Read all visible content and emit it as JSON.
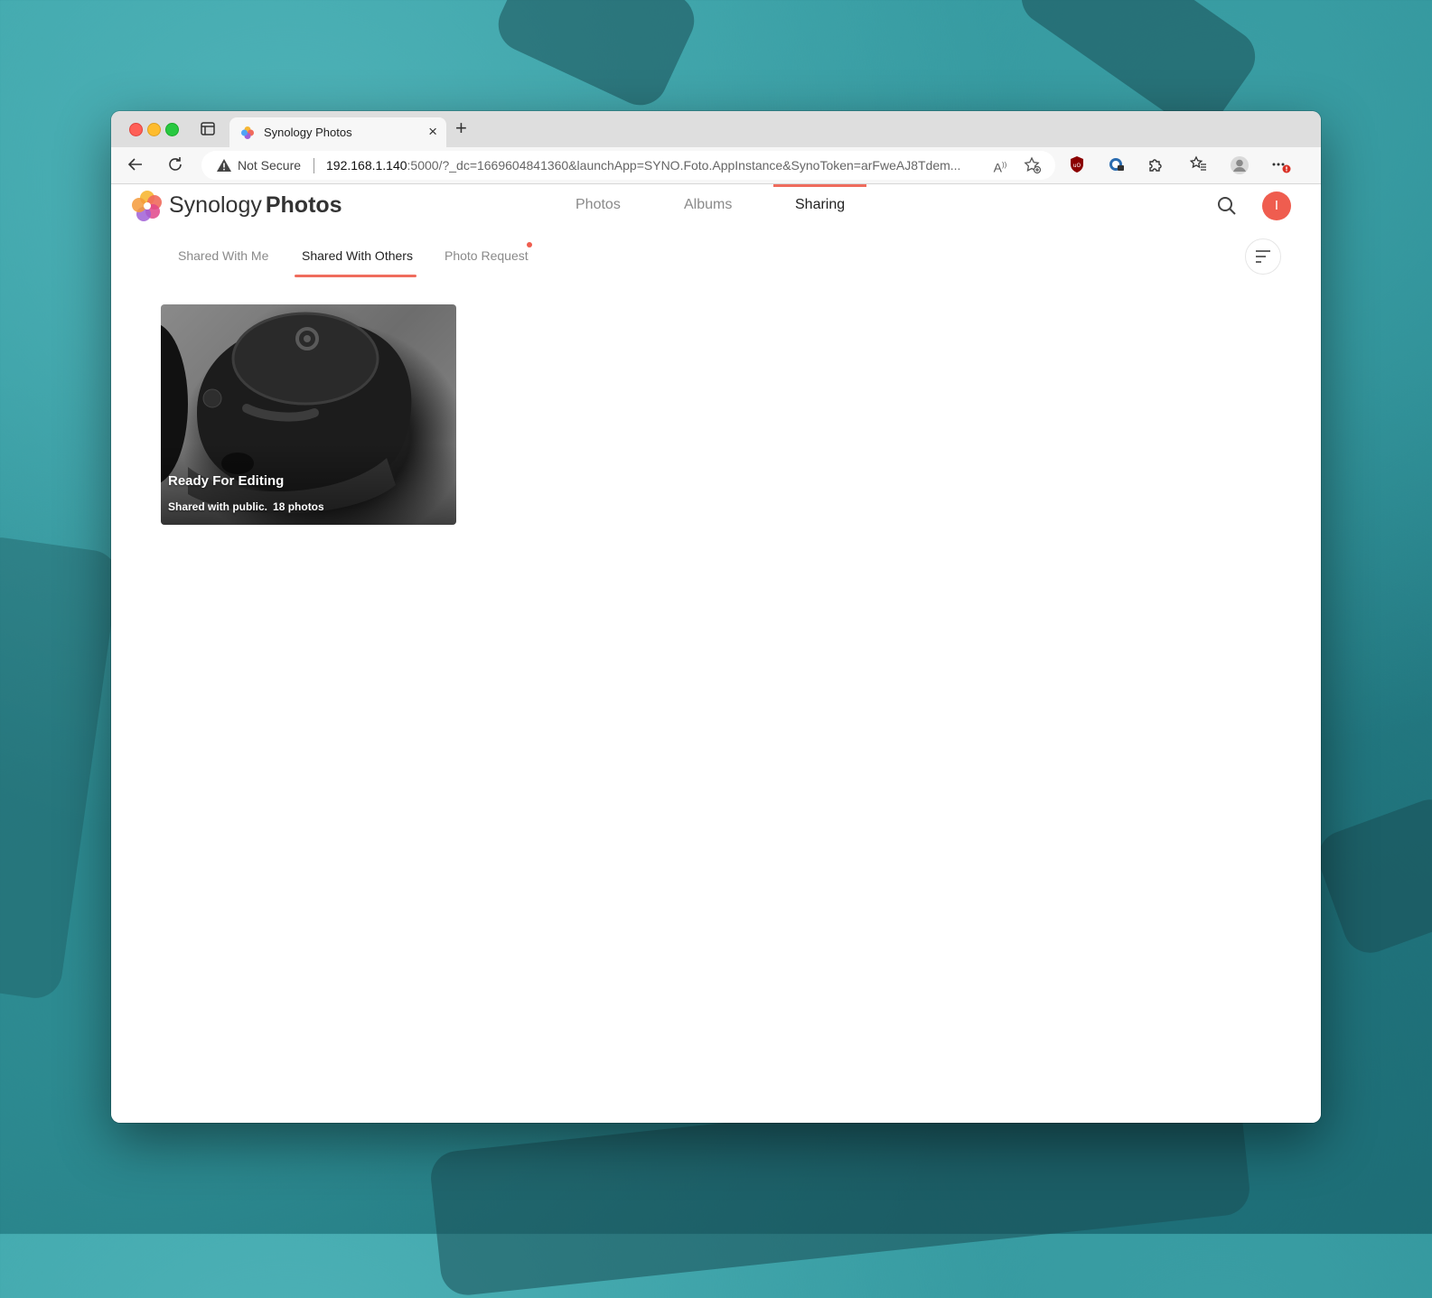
{
  "browser": {
    "tab_title": "Synology Photos",
    "new_tab_label": "+",
    "close_label": "×",
    "security_label": "Not Secure",
    "url_host": "192.168.1.140",
    "url_rest": ":5000/?_dc=1669604841360&launchApp=SYNO.Foto.AppInstance&SynoToken=arFweAJ8Tdem..."
  },
  "app": {
    "brand_light": "Synology",
    "brand_bold": "Photos",
    "nav": [
      "Photos",
      "Albums",
      "Sharing"
    ],
    "active_nav": "Sharing",
    "avatar_initial": "I",
    "subtabs": [
      "Shared With Me",
      "Shared With Others",
      "Photo Request"
    ],
    "active_subtab": "Shared With Others"
  },
  "albums": [
    {
      "title": "Ready For Editing",
      "share_status": "Shared with public.",
      "count": "18 photos"
    }
  ],
  "colors": {
    "accent": "#ef6c5d",
    "avatar": "#ef5d4f"
  }
}
